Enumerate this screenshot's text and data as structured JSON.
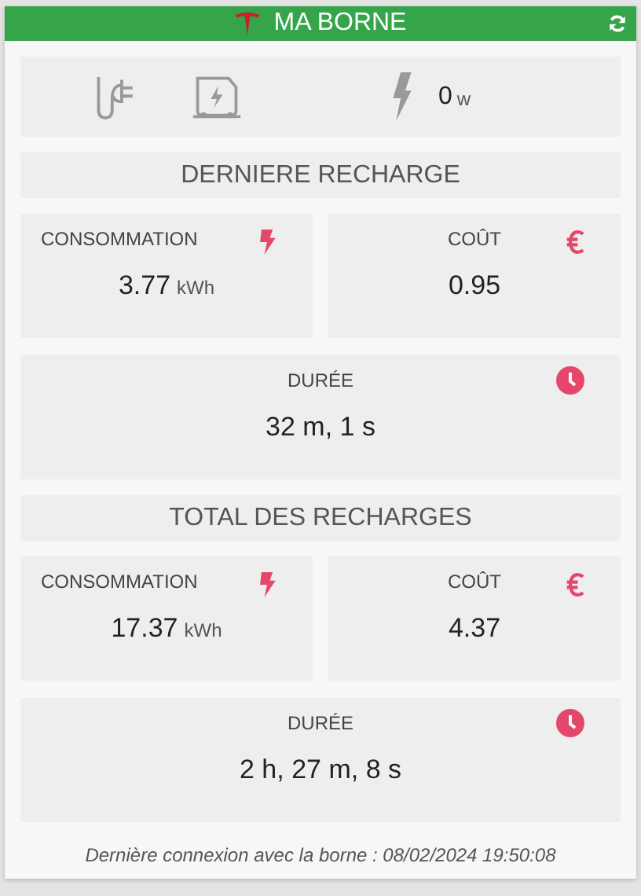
{
  "header": {
    "title": "MA BORNE"
  },
  "status": {
    "power": "0",
    "unit": "w"
  },
  "sections": [
    {
      "title": "DERNIERE RECHARGE",
      "tiles": [
        {
          "kind": "energy",
          "label": "CONSOMMATION",
          "value": "3.77",
          "unit": "kWh"
        },
        {
          "kind": "cost",
          "label": "COÛT",
          "value": "0.95"
        },
        {
          "kind": "duration",
          "label": "DURÉE",
          "value": "32 m, 1 s"
        }
      ]
    },
    {
      "title": "TOTAL DES RECHARGES",
      "tiles": [
        {
          "kind": "energy",
          "label": "CONSOMMATION",
          "value": "17.37",
          "unit": "kWh"
        },
        {
          "kind": "cost",
          "label": "COÛT",
          "value": "4.37"
        },
        {
          "kind": "duration",
          "label": "DURÉE",
          "value": "2 h, 27 m, 8 s"
        }
      ]
    }
  ],
  "footer": "Dernière connexion avec la borne : 08/02/2024 19:50:08"
}
